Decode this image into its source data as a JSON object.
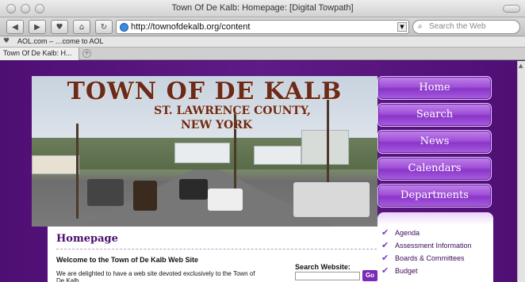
{
  "window": {
    "title": "Town Of De Kalb: Homepage: [Digital Towpath]"
  },
  "toolbar": {
    "url": "http://townofdekalb.org/content",
    "search_placeholder": "Search the Web",
    "back_icon": "back-arrow-icon",
    "forward_icon": "forward-arrow-icon",
    "bookmark_icon": "heart-icon",
    "home_icon": "home-icon",
    "reload_icon": "reload-icon"
  },
  "bookmarks": {
    "items": [
      "AOL.com – …come to AOL"
    ]
  },
  "tabs": [
    {
      "label": "Town Of De Kalb: H..."
    }
  ],
  "banner": {
    "title": "TOWN OF DE KALB",
    "subtitle_line1": "ST. LAWRENCE COUNTY,",
    "subtitle_line2": "NEW YORK"
  },
  "nav": {
    "items": [
      "Home",
      "Search",
      "News",
      "Calendars",
      "Departments"
    ]
  },
  "sidemenu": {
    "items": [
      "Agenda",
      "Assessment Information",
      "Boards & Committees",
      "Budget"
    ]
  },
  "content": {
    "title": "Homepage",
    "welcome": "Welcome to the Town of De Kalb Web Site",
    "intro": "We are delighted to have a web site devoted exclusively to the Town of De Kalb.",
    "search_label": "Search Website:",
    "search_button": "Go"
  },
  "colors": {
    "page_bg": "#4e0f73",
    "nav_button": "#a050d8",
    "heading": "#4b0f70",
    "banner_text": "#6b2a1b"
  }
}
